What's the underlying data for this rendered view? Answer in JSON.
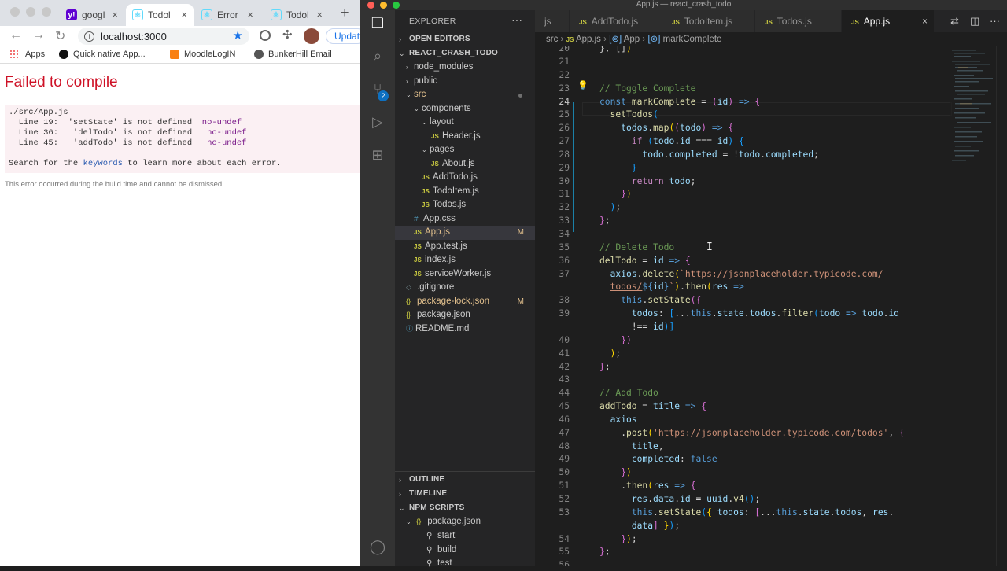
{
  "chrome": {
    "tabs": [
      {
        "label": "googl",
        "favicon": "yahoo-icon",
        "color": "#6001d2"
      },
      {
        "label": "Todol",
        "favicon": "react-icon",
        "color": "#61dafb"
      },
      {
        "label": "Error",
        "favicon": "react-icon",
        "color": "#61dafb"
      },
      {
        "label": "Todol",
        "favicon": "react-icon",
        "color": "#61dafb"
      }
    ],
    "address": "localhost:3000",
    "update_label": "Updat",
    "bookmarks": [
      "Apps",
      "Quick native App...",
      "MoodleLogIN",
      "BunkerHill Email"
    ]
  },
  "error_page": {
    "title": "Failed to compile",
    "file": "./src/App.js",
    "lines": [
      {
        "prefix": "  Line 19:  ",
        "msg": "'setState' is not defined  ",
        "rule": "no-undef"
      },
      {
        "prefix": "  Line 36:  ",
        "msg": " 'delTodo' is not defined   ",
        "rule": "no-undef"
      },
      {
        "prefix": "  Line 45:  ",
        "msg": " 'addTodo' is not defined   ",
        "rule": "no-undef"
      }
    ],
    "search_pre": "Search for the ",
    "search_kw": "keywords",
    "search_post": " to learn more about each error.",
    "footer": "This error occurred during the build time and cannot be dismissed."
  },
  "vscode": {
    "window_title": "App.js — react_crash_todo",
    "explorer_label": "EXPLORER",
    "open_editors": "OPEN EDITORS",
    "project": "REACT_CRASH_TODO",
    "tree": [
      {
        "label": "node_modules",
        "type": "folder",
        "depth": 1,
        "open": false
      },
      {
        "label": "public",
        "type": "folder",
        "depth": 1,
        "open": false
      },
      {
        "label": "src",
        "type": "folder",
        "depth": 1,
        "open": true,
        "modified_dot": true
      },
      {
        "label": "components",
        "type": "folder",
        "depth": 2,
        "open": true
      },
      {
        "label": "layout",
        "type": "folder",
        "depth": 3,
        "open": true
      },
      {
        "label": "Header.js",
        "type": "js",
        "depth": 4
      },
      {
        "label": "pages",
        "type": "folder",
        "depth": 3,
        "open": true
      },
      {
        "label": "About.js",
        "type": "js",
        "depth": 4
      },
      {
        "label": "AddTodo.js",
        "type": "js",
        "depth": 3
      },
      {
        "label": "TodoItem.js",
        "type": "js",
        "depth": 3
      },
      {
        "label": "Todos.js",
        "type": "js",
        "depth": 3
      },
      {
        "label": "App.css",
        "type": "css",
        "depth": 2
      },
      {
        "label": "App.js",
        "type": "js",
        "depth": 2,
        "selected": true,
        "status": "M"
      },
      {
        "label": "App.test.js",
        "type": "js",
        "depth": 2
      },
      {
        "label": "index.js",
        "type": "js",
        "depth": 2
      },
      {
        "label": "serviceWorker.js",
        "type": "js",
        "depth": 2
      },
      {
        "label": ".gitignore",
        "type": "git",
        "depth": 1
      },
      {
        "label": "package-lock.json",
        "type": "json",
        "depth": 1,
        "status": "M"
      },
      {
        "label": "package.json",
        "type": "json",
        "depth": 1
      },
      {
        "label": "README.md",
        "type": "info",
        "depth": 1
      }
    ],
    "outline": "OUTLINE",
    "timeline": "TIMELINE",
    "npm_scripts": "NPM SCRIPTS",
    "npm_package": "package.json",
    "npm_items": [
      "start",
      "build",
      "test"
    ],
    "tabs": [
      {
        "label": "js",
        "partial": true
      },
      {
        "label": "AddTodo.js"
      },
      {
        "label": "TodoItem.js"
      },
      {
        "label": "Todos.js"
      },
      {
        "label": "App.js",
        "active": true
      }
    ],
    "breadcrumb": [
      "src",
      "App.js",
      "App",
      "markComplete"
    ],
    "current_line": 24
  },
  "code_lines": [
    {
      "n": "20",
      "html": "<span class='op'>}, []</span><span class='pu'>)</span>"
    },
    {
      "n": "21",
      "html": ""
    },
    {
      "n": "22",
      "html": ""
    },
    {
      "n": "23",
      "html": "<span class='cm'>// Toggle Complete</span>"
    },
    {
      "n": "24",
      "html": "<span class='kw'>const</span> <span class='fn'>markComplete</span> <span class='op'>=</span> <span class='pk'>(</span><span class='vr'>id</span><span class='pk'>)</span> <span class='kw'>=&gt;</span> <span class='pk'>{</span>"
    },
    {
      "n": "25",
      "html": "  <span class='fn'>setTodos</span><span class='bl'>(</span>"
    },
    {
      "n": "26",
      "html": "    <span class='vr'>todos</span>.<span class='fn'>map</span><span class='pu'>(</span><span class='pk'>(</span><span class='vr'>todo</span><span class='pk'>)</span> <span class='kw'>=&gt;</span> <span class='pk'>{</span>"
    },
    {
      "n": "27",
      "html": "      <span class='ct'>if</span> <span class='bl'>(</span><span class='vr'>todo</span>.<span class='vr'>id</span> <span class='op'>===</span> <span class='vr'>id</span><span class='bl'>)</span> <span class='bl'>{</span>"
    },
    {
      "n": "28",
      "html": "        <span class='vr'>todo</span>.<span class='vr'>completed</span> <span class='op'>=</span> <span class='op'>!</span><span class='vr'>todo</span>.<span class='vr'>completed</span>;"
    },
    {
      "n": "29",
      "html": "      <span class='bl'>}</span>"
    },
    {
      "n": "30",
      "html": "      <span class='ct'>return</span> <span class='vr'>todo</span>;"
    },
    {
      "n": "31",
      "html": "    <span class='pk'>}</span><span class='pu'>)</span>"
    },
    {
      "n": "32",
      "html": "  <span class='bl'>)</span>;"
    },
    {
      "n": "33",
      "html": "<span class='pk'>}</span>;"
    },
    {
      "n": "34",
      "html": ""
    },
    {
      "n": "35",
      "html": "<span class='cm'>// Delete Todo</span>"
    },
    {
      "n": "36",
      "html": "<span class='fn'>delTodo</span> <span class='op'>=</span> <span class='vr'>id</span> <span class='kw'>=&gt;</span> <span class='pk'>{</span>"
    },
    {
      "n": "37",
      "html": "  <span class='vr'>axios</span>.<span class='fn'>delete</span><span class='pu'>(</span><span class='str'>`<u>https://jsonplaceholder.typicode.com/</u></span>"
    },
    {
      "n": "",
      "html": "  <span class='str'><u>todos/</u></span><span class='kw'>${</span><span class='vr'>id</span><span class='kw'>}</span><span class='str'>`</span><span class='pu'>)</span>.<span class='fn'>then</span><span class='pu'>(</span><span class='vr'>res</span> <span class='kw'>=&gt;</span>"
    },
    {
      "n": "38",
      "html": "    <span class='th'>this</span>.<span class='fn'>setState</span><span class='pk'>({</span>"
    },
    {
      "n": "39",
      "html": "      <span class='vr'>todos</span>: <span class='bl'>[</span>...<span class='th'>this</span>.<span class='vr'>state</span>.<span class='vr'>todos</span>.<span class='fn'>filter</span><span class='bl'>(</span><span class='vr'>todo</span> <span class='kw'>=&gt;</span> <span class='vr'>todo</span>.<span class='vr'>id</span>"
    },
    {
      "n": "",
      "html": "      <span class='op'>!==</span> <span class='vr'>id</span><span class='bl'>)]</span>"
    },
    {
      "n": "40",
      "html": "    <span class='pk'>})</span>"
    },
    {
      "n": "41",
      "html": "  <span class='pu'>)</span>;"
    },
    {
      "n": "42",
      "html": "<span class='pk'>}</span>;"
    },
    {
      "n": "43",
      "html": ""
    },
    {
      "n": "44",
      "html": "<span class='cm'>// Add Todo</span>"
    },
    {
      "n": "45",
      "html": "<span class='fn'>addTodo</span> <span class='op'>=</span> <span class='vr'>title</span> <span class='kw'>=&gt;</span> <span class='pk'>{</span>"
    },
    {
      "n": "46",
      "html": "  <span class='vr'>axios</span>"
    },
    {
      "n": "47",
      "html": "    .<span class='fn'>post</span><span class='pu'>(</span><span class='str'>'<u>https://jsonplaceholder.typicode.com/todos</u>'</span>, <span class='pk'>{</span>"
    },
    {
      "n": "48",
      "html": "      <span class='vr'>title</span>,"
    },
    {
      "n": "49",
      "html": "      <span class='vr'>completed</span>: <span class='kw'>false</span>"
    },
    {
      "n": "50",
      "html": "    <span class='pk'>}</span><span class='pu'>)</span>"
    },
    {
      "n": "51",
      "html": "    .<span class='fn'>then</span><span class='pu'>(</span><span class='vr'>res</span> <span class='kw'>=&gt;</span> <span class='pk'>{</span>"
    },
    {
      "n": "52",
      "html": "      <span class='vr'>res</span>.<span class='vr'>data</span>.<span class='vr'>id</span> <span class='op'>=</span> <span class='vr'>uuid</span>.<span class='fn'>v4</span><span class='bl'>()</span>;"
    },
    {
      "n": "53",
      "html": "      <span class='th'>this</span>.<span class='fn'>setState</span><span class='bl'>(</span><span class='pu'>{</span> <span class='vr'>todos</span>: <span class='pk'>[</span>...<span class='th'>this</span>.<span class='vr'>state</span>.<span class='vr'>todos</span>, <span class='vr'>res</span>."
    },
    {
      "n": "",
      "html": "      <span class='vr'>data</span><span class='pk'>]</span> <span class='pu'>}</span><span class='bl'>)</span>;"
    },
    {
      "n": "54",
      "html": "    <span class='pk'>}</span><span class='pu'>)</span>;"
    },
    {
      "n": "55",
      "html": "<span class='pk'>}</span>;"
    },
    {
      "n": "56",
      "html": ""
    }
  ]
}
